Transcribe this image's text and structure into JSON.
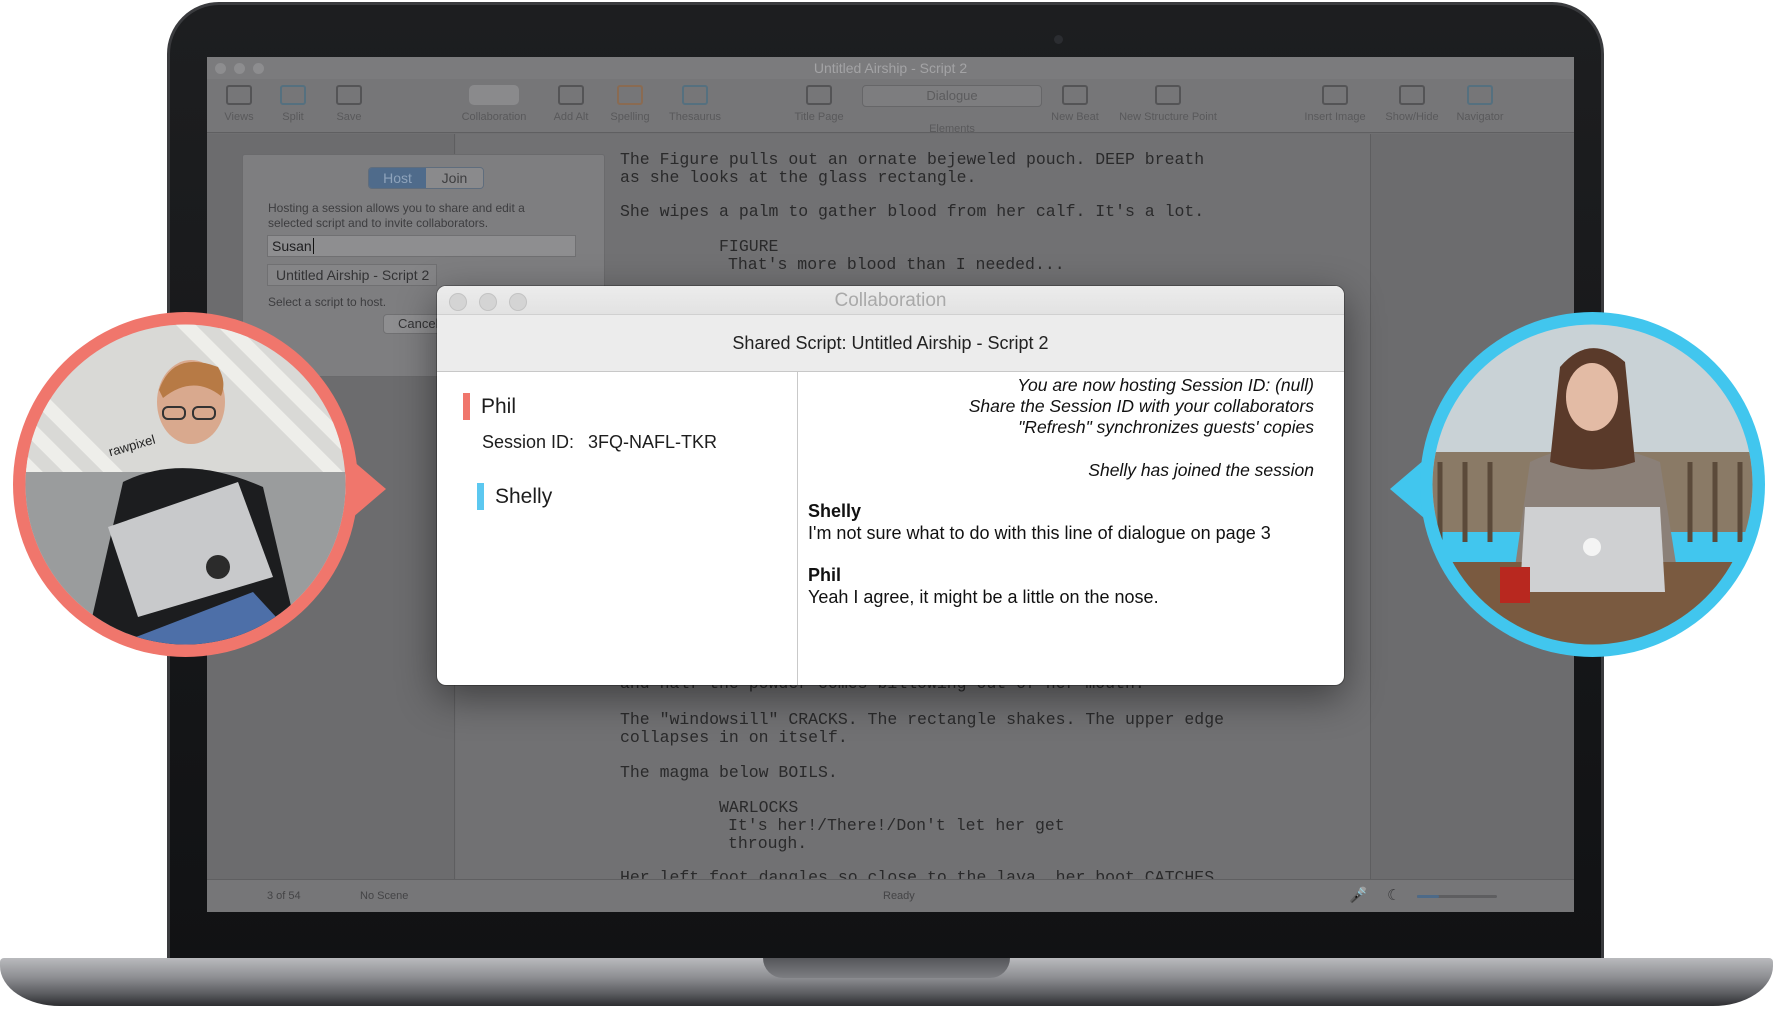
{
  "app": {
    "window_title": "Untitled Airship - Script 2",
    "toolbar": {
      "views": "Views",
      "split": "Split",
      "save": "Save",
      "collaboration": "Collaboration",
      "add_alt": "Add Alt",
      "spelling": "Spelling",
      "thesaurus": "Thesaurus",
      "title_page": "Title Page",
      "elements_value": "Dialogue",
      "elements_label": "Elements",
      "new_beat": "New Beat",
      "new_structure_point": "New Structure Point",
      "insert_image": "Insert Image",
      "show_hide": "Show/Hide",
      "navigator": "Navigator"
    },
    "script_lines": {
      "action1": "The Figure pulls out an ornate bejeweled pouch. DEEP breath\nas she looks at the glass rectangle.",
      "action2": "She wipes a palm to gather blood from her calf. It's a lot.",
      "char1": "          FIGURE",
      "dialog1": "That's more blood than I needed...",
      "action3": "and half the powder comes billowing out of her mouth.",
      "action4": "The \"windowsill\" CRACKS. The rectangle shakes. The upper edge\ncollapses in on itself.",
      "action5": "The magma below BOILS.",
      "char2": "          WARLOCKS",
      "dialog2": "It's her!/There!/Don't let her get\nthrough.",
      "action6": "Her left foot dangles so close to the lava, her boot CATCHES"
    },
    "status": {
      "page": "3 of 54",
      "scene": "No Scene",
      "state": "Ready"
    }
  },
  "host_sheet": {
    "tab_host": "Host",
    "tab_join": "Join",
    "description": "Hosting a session allows you to share and edit a selected script and to invite collaborators.",
    "name_value": "Susan",
    "script_select": "Untitled Airship - Script 2",
    "hint": "Select a script to host.",
    "cancel_label": "Cancel"
  },
  "collaboration": {
    "title": "Collaboration",
    "shared_script": "Shared Script: Untitled Airship - Script 2",
    "users": [
      {
        "name": "Phil",
        "color": "#f0766c"
      },
      {
        "name": "Shelly",
        "color": "#5cc8f0"
      }
    ],
    "session_label": "Session ID:",
    "session_id": "3FQ-NAFL-TKR",
    "system_messages": [
      "You are now hosting Session ID: (null)",
      "Share the Session ID with your collaborators",
      "\"Refresh\" synchronizes guests' copies"
    ],
    "join_message": "Shelly has joined the session",
    "messages": [
      {
        "author": "Shelly",
        "text": "I'm not sure what to do with this line of dialogue on page 3"
      },
      {
        "author": "Phil",
        "text": "Yeah I agree, it might be a little on the nose."
      }
    ]
  },
  "avatars": {
    "left_ring_color": "#f0766c",
    "right_ring_color": "#41c6ee",
    "laptop_sticker": "rawpixel"
  }
}
